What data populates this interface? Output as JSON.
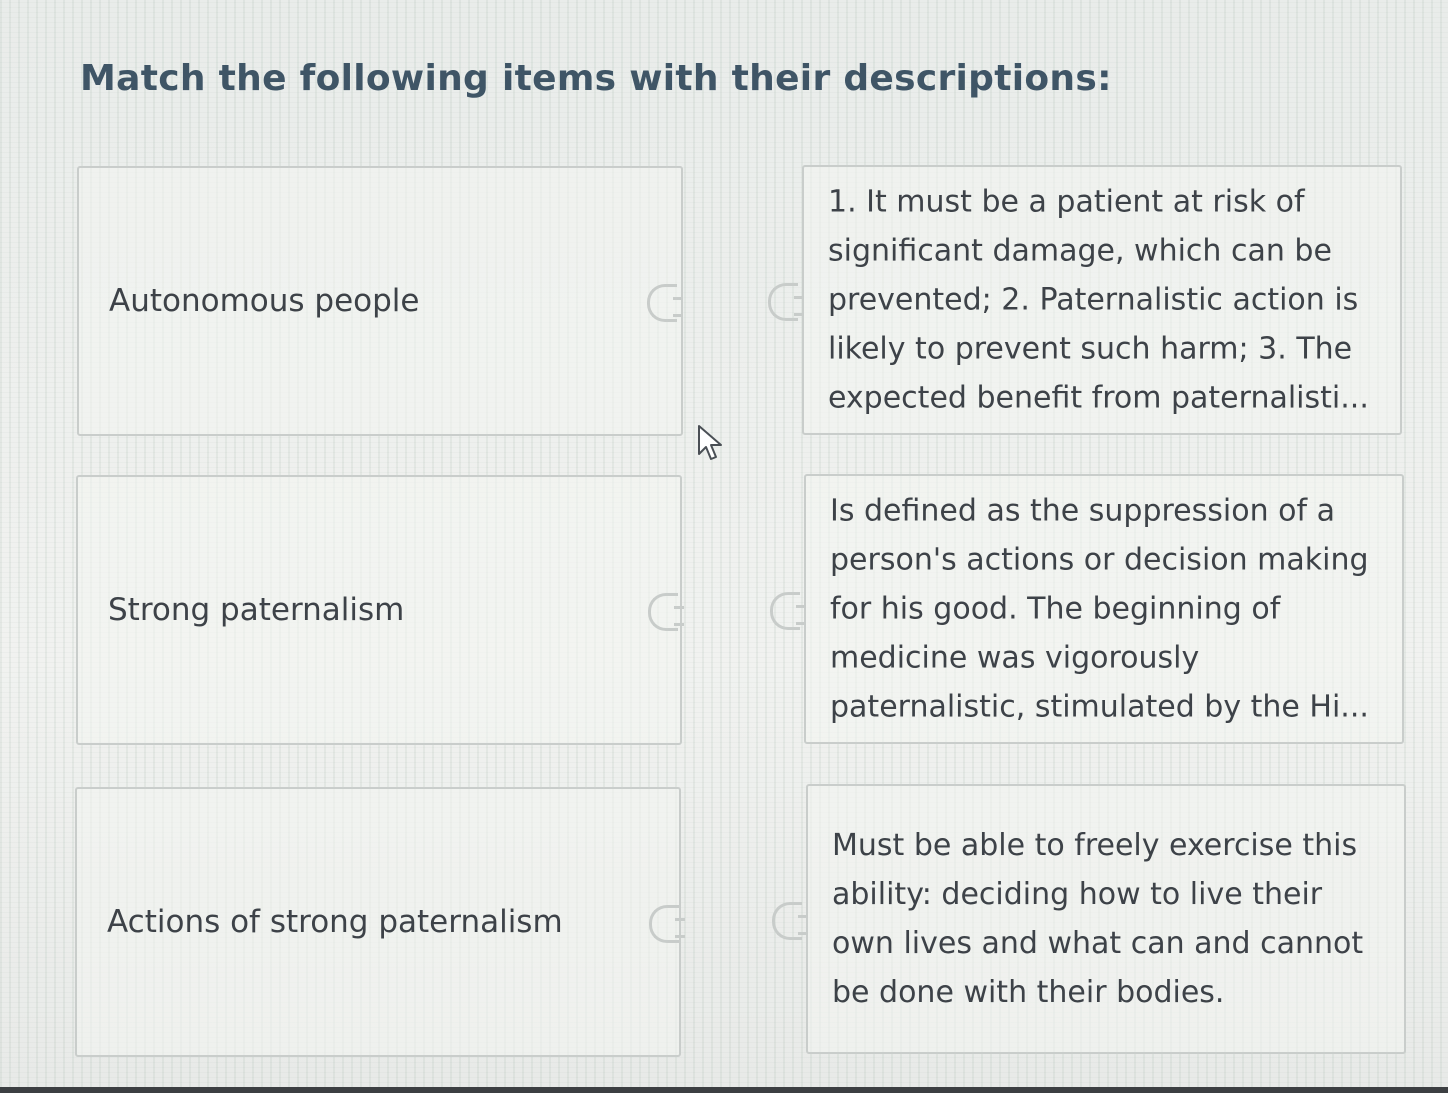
{
  "title": "Match the following items with their descriptions:",
  "items": [
    {
      "label": "Autonomous people"
    },
    {
      "label": "Strong paternalism"
    },
    {
      "label": "Actions of strong paternalism"
    }
  ],
  "descriptions": [
    {
      "text": "1. It must be a patient at risk of significant damage, which can be prevented; 2. Paternalistic action is likely to prevent such harm; 3. The expected benefit from paternalisti..."
    },
    {
      "text": "Is defined as the suppression of a person's actions or decision making for his good. The beginning of medicine was vigorously paternalistic, stimulated by the Hi..."
    },
    {
      "text": "Must be able to freely exercise this ability: deciding how to live their own lives and what can and cannot be done with their bodies."
    }
  ],
  "icons": {
    "connector": "puzzle-tab-icon",
    "pointer": "mouse-pointer-icon"
  }
}
